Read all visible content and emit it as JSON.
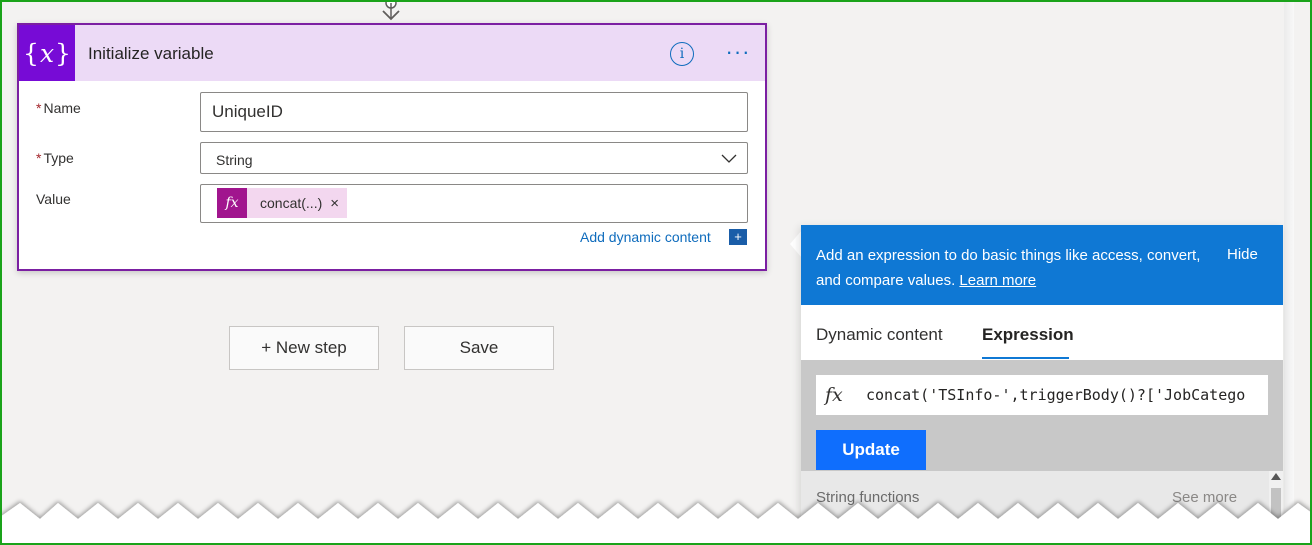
{
  "card": {
    "icon_text": "{x}",
    "title": "Initialize variable",
    "info_icon": "i",
    "more_icon": "···",
    "fields": {
      "name_label": "Name",
      "name_value": "UniqueID",
      "type_label": "Type",
      "type_value": "String",
      "value_label": "Value",
      "token_icon": "fx",
      "token_label": "concat(...)",
      "token_remove": "×"
    },
    "add_dynamic": "Add dynamic content",
    "add_dynamic_icon": "+"
  },
  "actions": {
    "new_step": "+ New step",
    "save": "Save"
  },
  "panel": {
    "description": "Add an expression to do basic things like access, convert, and compare values.",
    "learn_more": "Learn more",
    "hide": "Hide",
    "tabs": [
      "Dynamic content",
      "Expression"
    ],
    "active_tab": "Expression",
    "expression_icon": "fx",
    "expression": "concat('TSInfo-',triggerBody()?['JobCatego",
    "update": "Update",
    "section": "String functions",
    "see_more": "See more"
  },
  "colors": {
    "accent": "#770bd6",
    "header_bg": "#ecdaf6",
    "token": "#a1158e",
    "panel_header": "#0f78d4",
    "primary_button": "#0f6efd",
    "link": "#0f6cbd",
    "frame": "#1aa31a"
  },
  "icons": {
    "variable": "curly-x-icon",
    "info": "info-icon",
    "more": "more-options-icon",
    "dropdown": "chevron-down-icon",
    "function": "fx-icon",
    "connector": "down-arrow-icon"
  }
}
